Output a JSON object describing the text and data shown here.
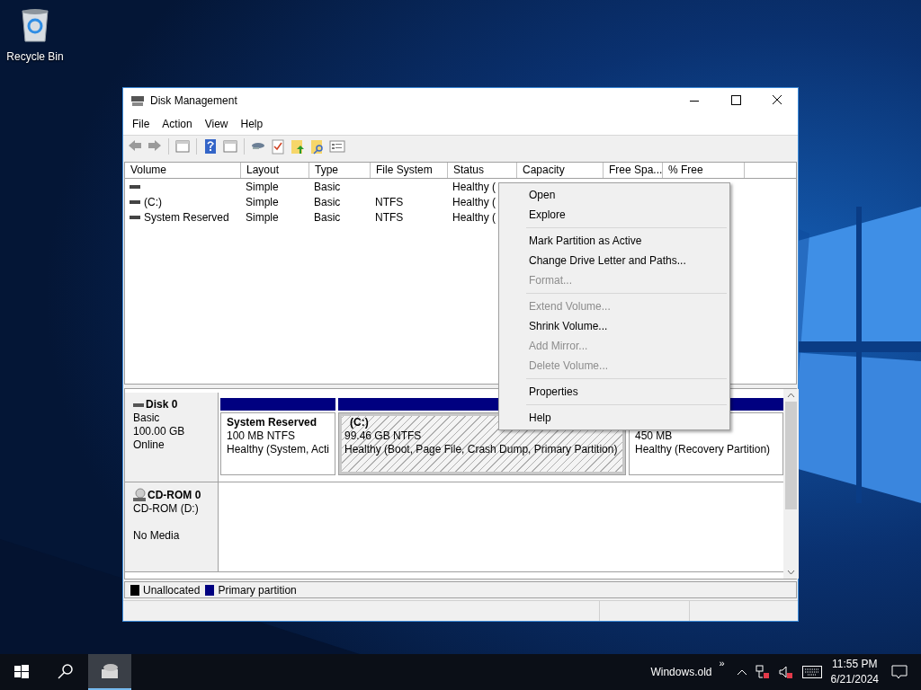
{
  "desktop_icons": [
    {
      "label": "Recycle Bin"
    }
  ],
  "window": {
    "title": "Disk Management"
  },
  "menu_bar": [
    "File",
    "Action",
    "View",
    "Help"
  ],
  "volume_list": {
    "columns": [
      "Volume",
      "Layout",
      "Type",
      "File System",
      "Status",
      "Capacity",
      "Free Spa...",
      "% Free"
    ],
    "rows": [
      {
        "layout": "Simple",
        "type": "Basic",
        "status": "Healthy ("
      },
      {
        "volume": "(C:)",
        "layout": "Simple",
        "type": "Basic",
        "file_system": "NTFS",
        "status": "Healthy ("
      },
      {
        "volume": "System Reserved",
        "layout": "Simple",
        "type": "Basic",
        "file_system": "NTFS",
        "status": "Healthy ("
      }
    ]
  },
  "disks": [
    {
      "kind": "disk",
      "name": "Disk 0",
      "type": "Basic",
      "size": "100.00 GB",
      "status": "Online",
      "partitions": [
        {
          "label": "System Reserved",
          "size": "100 MB NTFS",
          "status": "Healthy (System, Acti",
          "selected": false
        },
        {
          "label": "(C:)",
          "size": "99.46 GB NTFS",
          "status": "Healthy (Boot, Page File, Crash Dump, Primary Partition)",
          "selected": true
        },
        {
          "size": "450 MB",
          "status": "Healthy (Recovery Partition)",
          "selected": false
        }
      ]
    },
    {
      "kind": "cdrom",
      "name": "CD-ROM 0",
      "type": "CD-ROM (D:)",
      "status": "No Media"
    }
  ],
  "legend": [
    {
      "label": "Unallocated",
      "color": "#000000"
    },
    {
      "label": "Primary partition",
      "color": "#000080"
    }
  ],
  "context_menu": [
    {
      "kind": "item",
      "label": "Open",
      "disabled": false
    },
    {
      "kind": "item",
      "label": "Explore",
      "disabled": false
    },
    {
      "kind": "separator"
    },
    {
      "kind": "item",
      "label": "Mark Partition as Active",
      "disabled": false
    },
    {
      "kind": "item",
      "label": "Change Drive Letter and Paths...",
      "disabled": false
    },
    {
      "kind": "item",
      "label": "Format...",
      "disabled": true
    },
    {
      "kind": "separator"
    },
    {
      "kind": "item",
      "label": "Extend Volume...",
      "disabled": true
    },
    {
      "kind": "item",
      "label": "Shrink Volume...",
      "disabled": false
    },
    {
      "kind": "item",
      "label": "Add Mirror...",
      "disabled": true
    },
    {
      "kind": "item",
      "label": "Delete Volume...",
      "disabled": true
    },
    {
      "kind": "separator"
    },
    {
      "kind": "item",
      "label": "Properties",
      "disabled": false
    },
    {
      "kind": "separator"
    },
    {
      "kind": "item",
      "label": "Help",
      "disabled": false
    }
  ],
  "taskbar": {
    "toolbar_label": "Windows.old",
    "toolbar_chevron": "»",
    "time": "11:55 PM",
    "date": "6/21/2024"
  }
}
